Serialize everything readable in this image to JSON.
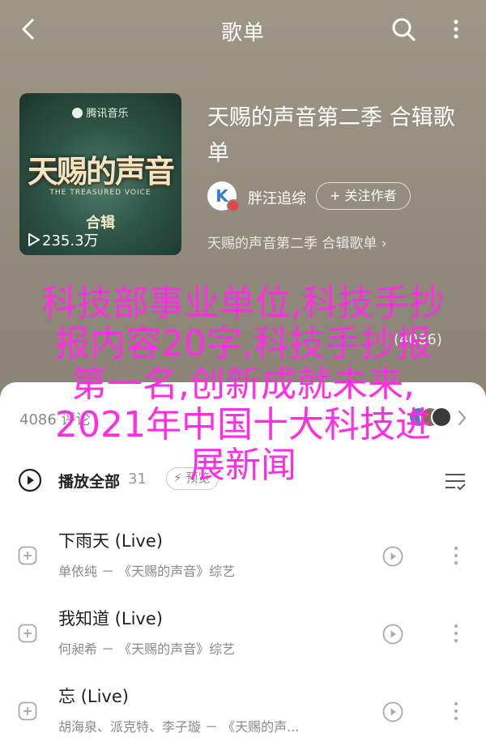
{
  "header": {
    "title": "歌单"
  },
  "album": {
    "cover_brand": "腾讯音乐",
    "cover_logo": "天赐的声音",
    "cover_subtitle": "THE TREASURED VOICE",
    "cover_tag": "合辑",
    "play_count": "235.3万",
    "title": "天赐的声音第二季 合辑歌单",
    "artist_initial": "K",
    "artist": "胖汪追综",
    "follow_label": "+ 关注作者",
    "subtitle": "天赐的声音第二季 合辑歌单 ›"
  },
  "stats": {
    "share_count": "(4086)"
  },
  "comments": {
    "count": "4086 评论"
  },
  "playlist": {
    "play_all_label": "播放全部",
    "play_all_count": "31",
    "preview_label": "预览"
  },
  "songs": [
    {
      "name": "下雨天 (Live)",
      "meta": "单依纯 － 《天赐的声音》综艺"
    },
    {
      "name": "我知道 (Live)",
      "meta": "何昶希 － 《天赐的声音》综艺"
    },
    {
      "name": "忘 (Live)",
      "meta": "胡海泉、派克特、李子璇 － 《天赐的声..."
    }
  ],
  "overlay": {
    "lines": [
      "科技部事业单位,科技手抄",
      "报内容20字,科技手抄报",
      "第一名,创新成就未来,",
      "2021年中国十大科技进",
      "展新闻"
    ]
  },
  "colors": {
    "overlay": "#ff2ee3",
    "background": "#918a7c",
    "sheet": "#ffffff"
  }
}
